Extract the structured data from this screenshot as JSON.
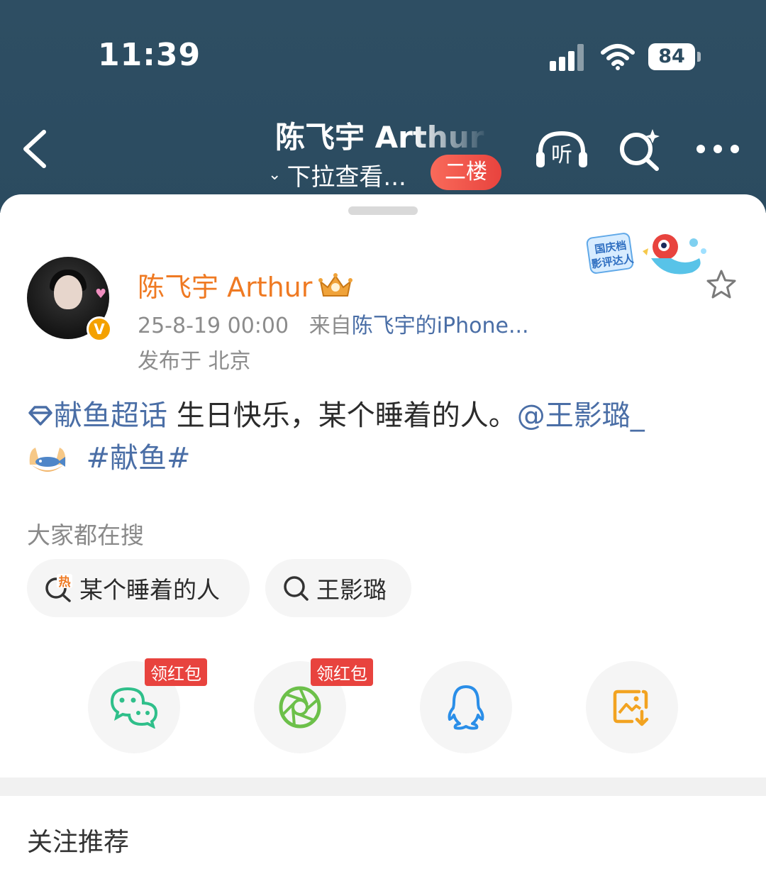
{
  "status_bar": {
    "time": "11:39",
    "battery": "84"
  },
  "nav": {
    "title": "陈飞宇 Arthur",
    "pull_hint": "下拉查看...",
    "floor_badge": "二楼",
    "listen_label": "听"
  },
  "post": {
    "username": "陈飞宇 Arthur",
    "timestamp": "25-8-19 00:00",
    "source_prefix": "来自",
    "source": "陈飞宇的iPhone...",
    "location": "发布于 北京",
    "topic": "献鱼超话",
    "text": " 生日快乐，某个睡着的人。",
    "mention": "@王影璐_",
    "hashtag": "#献鱼#",
    "verified_mark": "V",
    "sticker_text": "国庆档\n影评达人"
  },
  "hot_search": {
    "title": "大家都在搜",
    "items": [
      {
        "label": "某个睡着的人",
        "icon": "hot-search-icon",
        "hot_mark": "热"
      },
      {
        "label": "王影璐",
        "icon": "search-icon"
      }
    ]
  },
  "share": {
    "items": [
      {
        "name": "wechat",
        "tag": "领红包"
      },
      {
        "name": "moments",
        "tag": "领红包"
      },
      {
        "name": "qq",
        "tag": ""
      },
      {
        "name": "save-image",
        "tag": ""
      }
    ]
  },
  "recommend": {
    "title": "关注推荐"
  },
  "colors": {
    "header_bg": "#2b4b60",
    "username": "#ef7a23",
    "link": "#4a6ea6",
    "badge_red": "#e8433e"
  }
}
